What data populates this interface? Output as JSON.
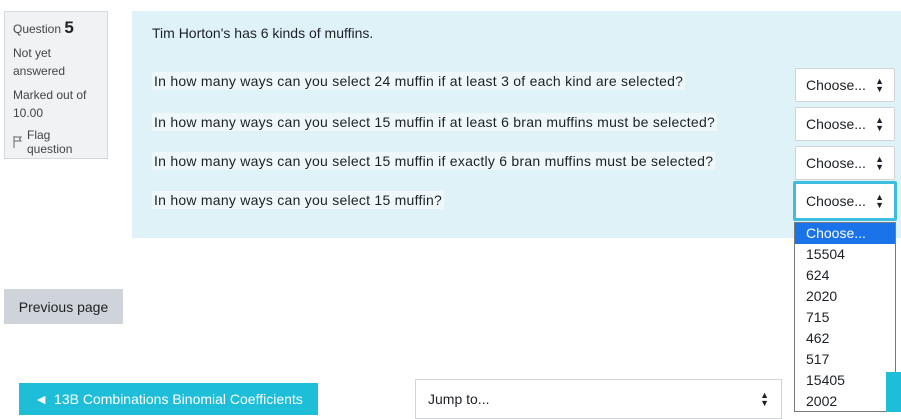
{
  "question_info": {
    "label": "Question",
    "number": "5",
    "state": "Not yet answered",
    "grade": "Marked out of 10.00",
    "flag_label": "Flag question"
  },
  "formulation": {
    "intro": "Tim Horton's has 6 kinds of muffins.",
    "subquestions": [
      {
        "text": "In how many ways can you select 24 muffin if at least 3 of each kind are selected?",
        "selected": "Choose..."
      },
      {
        "text": "In how many ways can you select 15 muffin if at least 6 bran muffins must be selected?",
        "selected": "Choose..."
      },
      {
        "text": "In how many ways can you select 15 muffin if exactly 6 bran muffins must be selected?",
        "selected": "Choose..."
      },
      {
        "text": "In how many ways can you select 15 muffin?",
        "selected": "Choose..."
      }
    ]
  },
  "dropdown": {
    "options": [
      "Choose...",
      "15504",
      "624",
      "2020",
      "715",
      "462",
      "517",
      "15405",
      "2002"
    ]
  },
  "navigation": {
    "previous_label": "Previous page",
    "prev_activity_label": "13B Combinations Binomial Coefficients",
    "jump_placeholder": "Jump to...",
    "accent_color": "#1ebdd8"
  }
}
